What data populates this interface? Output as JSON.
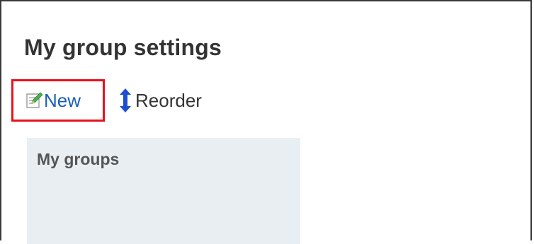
{
  "page": {
    "title": "My group settings"
  },
  "toolbar": {
    "new_label": "New",
    "new_icon": "edit-note-icon",
    "reorder_label": "Reorder",
    "reorder_icon": "vertical-arrows-icon",
    "highlight_color": "#e8101c",
    "link_color": "#1a5fb8"
  },
  "groups_panel": {
    "title": "My groups",
    "background": "#e9eef3"
  }
}
